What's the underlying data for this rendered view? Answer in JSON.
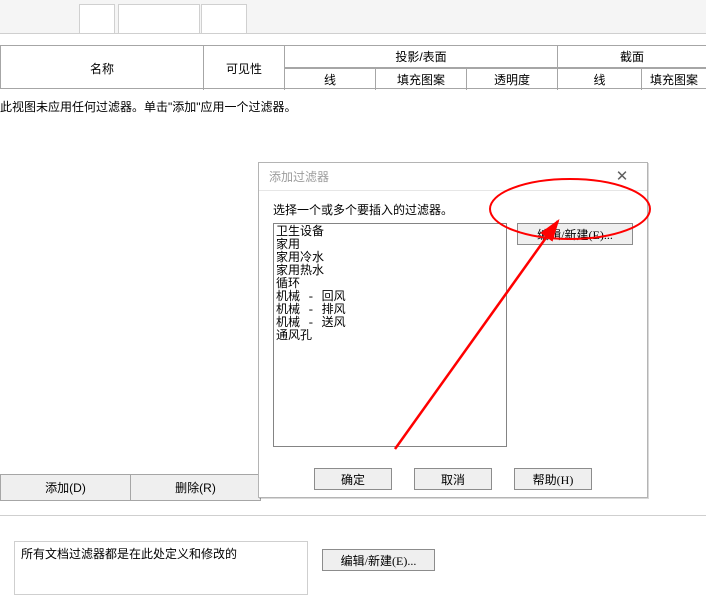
{
  "table": {
    "name": "名称",
    "visible": "可见性",
    "group_proj": "投影/表面",
    "group_cut": "截面",
    "line": "线",
    "pattern": "填充图案",
    "transparency": "透明度",
    "pattern2": "填充图案"
  },
  "message": "此视图未应用任何过滤器。单击\"添加\"应用一个过滤器。",
  "toolbar": {
    "add": "添加(D)",
    "delete": "删除(R)"
  },
  "footer": {
    "desc": "所有文档过滤器都是在此处定义和修改的",
    "edit": "编辑/新建(E)..."
  },
  "dialog": {
    "title": "添加过滤器",
    "prompt": "选择一个或多个要插入的过滤器。",
    "edit": "编辑/新建(E)...",
    "ok": "确定",
    "cancel": "取消",
    "help": "帮助(H)",
    "items": [
      "卫生设备",
      "家用",
      "家用冷水",
      "家用热水",
      "循环",
      "机械 - 回风",
      "机械 - 排风",
      "机械 - 送风",
      "通风孔"
    ]
  }
}
